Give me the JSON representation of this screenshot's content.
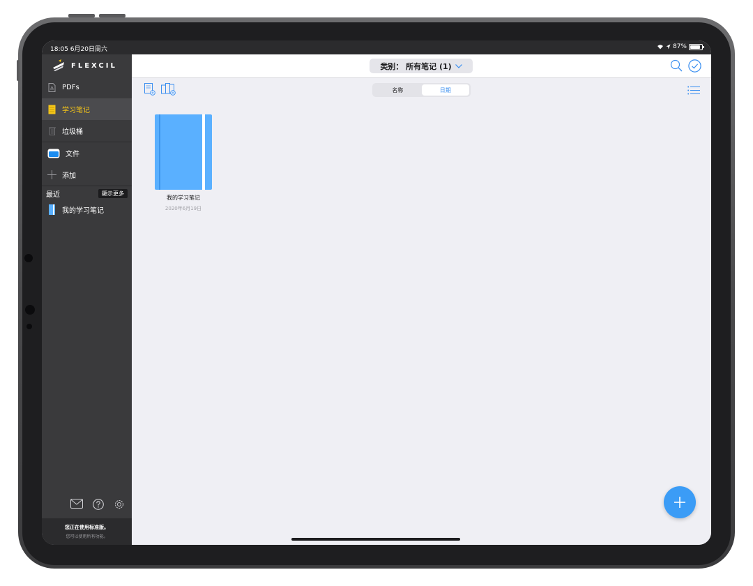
{
  "status_bar": {
    "time_date": "18:05  6月20日周六",
    "battery": "87%"
  },
  "app": {
    "name": "FLEXCIL"
  },
  "sidebar": {
    "items": [
      {
        "label": "PDFs",
        "icon": "pdf-icon"
      },
      {
        "label": "学习笔记",
        "icon": "notebook-icon",
        "active": true
      },
      {
        "label": "垃圾桶",
        "icon": "trash-icon"
      }
    ],
    "files_label": "文件",
    "add_label": "添加",
    "recent_label": "最近",
    "show_more_label": "顯示更多",
    "recent_items": [
      {
        "label": "我的学习笔记",
        "icon": "notebook-icon"
      }
    ],
    "footer": {
      "line1": "您正在使用标准版。",
      "line2": "您可以使用所有功能。"
    }
  },
  "header": {
    "category_label": "类别： 所有笔记 (1)"
  },
  "sort_tabs": [
    {
      "label": "名称",
      "active": false
    },
    {
      "label": "日期",
      "active": true
    }
  ],
  "notebooks": [
    {
      "title": "我的学习笔记",
      "date": "2020年6月19日",
      "cover_color": "#5ab0ff"
    }
  ],
  "colors": {
    "accent": "#3b8ff0",
    "active_sidebar_text": "#f5c518",
    "sidebar_bg": "#3a3a3c"
  }
}
